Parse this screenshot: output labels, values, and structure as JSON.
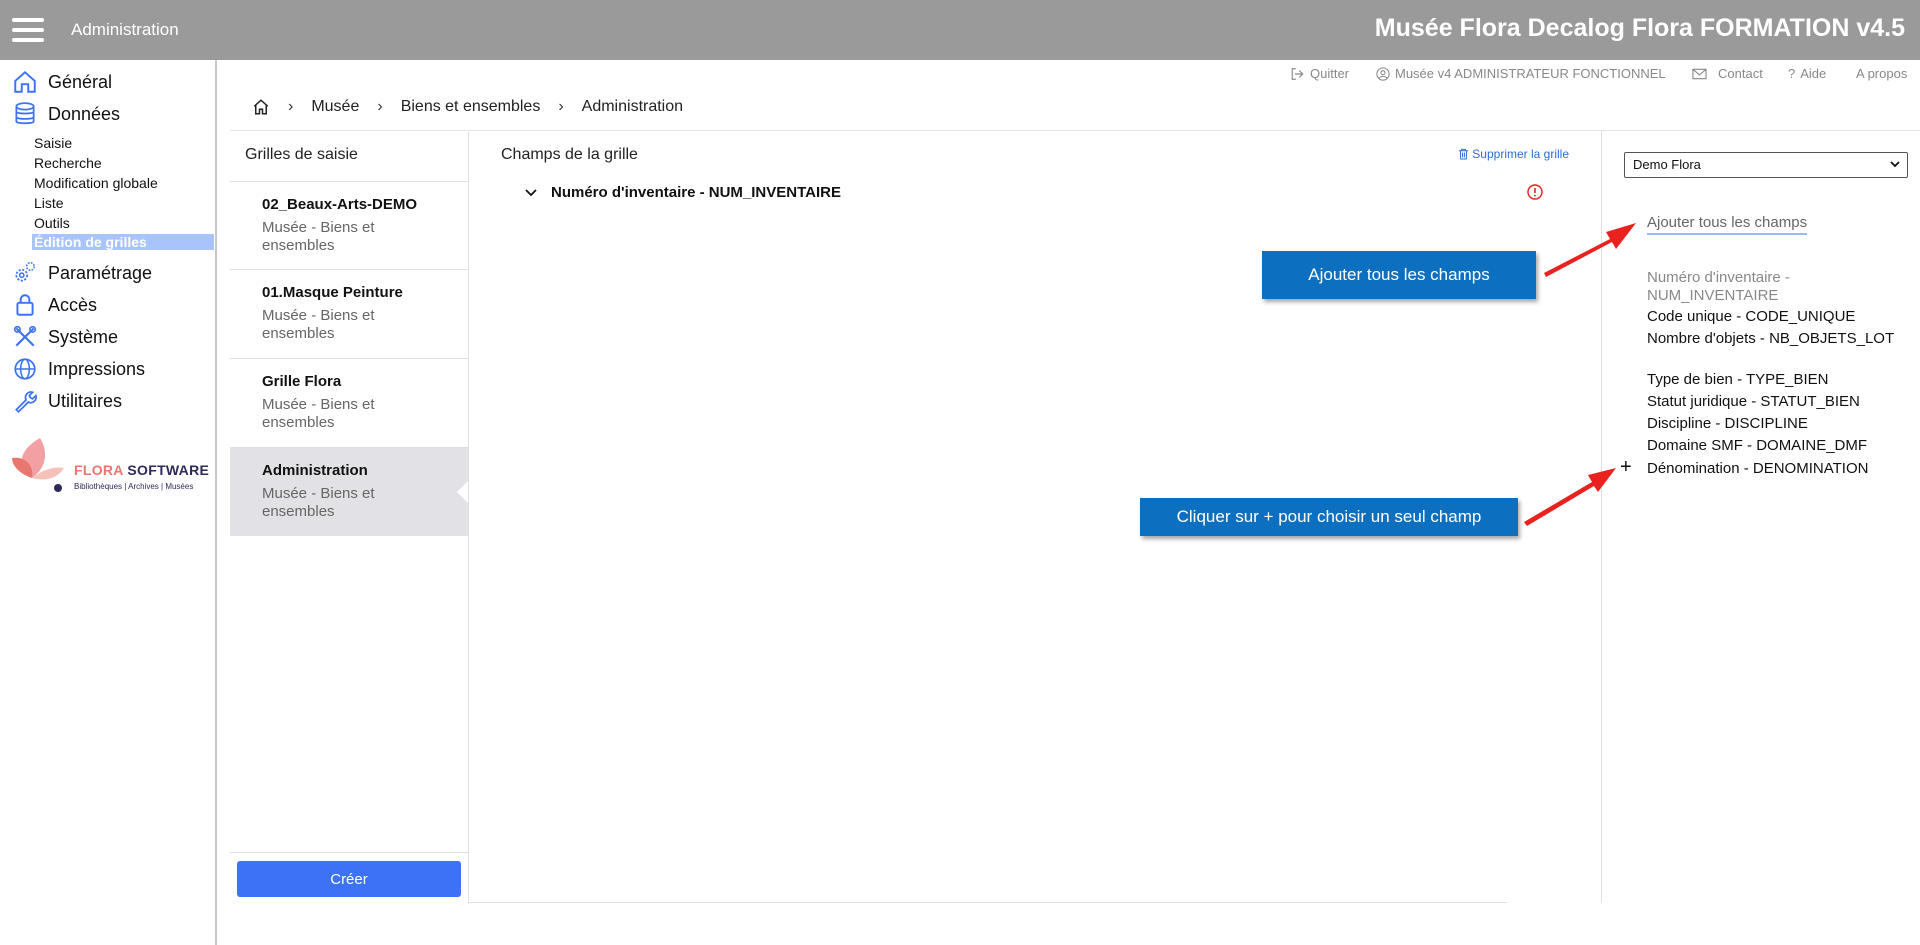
{
  "header": {
    "section": "Administration",
    "app_title": "Musée Flora Decalog Flora FORMATION v4.5"
  },
  "sidebar": {
    "main_items": [
      {
        "label": "Général",
        "icon": "home-icon"
      },
      {
        "label": "Données",
        "icon": "database-icon"
      },
      {
        "label": "Paramétrage",
        "icon": "gears-icon"
      },
      {
        "label": "Accès",
        "icon": "lock-icon"
      },
      {
        "label": "Système",
        "icon": "tools-icon"
      },
      {
        "label": "Impressions",
        "icon": "globe-icon"
      },
      {
        "label": "Utilitaires",
        "icon": "wrench-icon"
      }
    ],
    "sub_items": [
      "Saisie",
      "Recherche",
      "Modification globale",
      "Liste",
      "Outils",
      "Édition de grilles"
    ],
    "active_sub": "Édition de grilles"
  },
  "logo": {
    "brand_flora": "FLORA",
    "brand_software": " SOFTWARE",
    "tagline": "Bibliothèques | Archives | Musées"
  },
  "toplinks": {
    "quit": "Quitter",
    "user": "Musée v4 ADMINISTRATEUR FONCTIONNEL",
    "contact": "Contact",
    "help": "Aide",
    "about": "A propos"
  },
  "breadcrumb": [
    "Musée",
    "Biens et ensembles",
    "Administration"
  ],
  "grids_panel": {
    "title": "Grilles de saisie",
    "items": [
      {
        "name": "02_Beaux-Arts-DEMO",
        "sub": "Musée - Biens et ensembles"
      },
      {
        "name": "01.Masque Peinture",
        "sub": "Musée - Biens et ensembles"
      },
      {
        "name": "Grille Flora",
        "sub": "Musée - Biens et ensembles"
      },
      {
        "name": "Administration",
        "sub": "Musée - Biens et ensembles"
      }
    ],
    "selected": "Administration",
    "create_label": "Créer"
  },
  "fields_panel": {
    "title": "Champs de la grille",
    "delete_label": "Supprimer la grille",
    "fields": [
      {
        "label": "Numéro d'inventaire - NUM_INVENTAIRE",
        "status": "error"
      }
    ]
  },
  "available_panel": {
    "select_value": "Demo Flora",
    "add_all_label": "Ajouter tous les champs",
    "fields": [
      {
        "label": "Numéro d'inventaire - NUM_INVENTAIRE",
        "state": "added"
      },
      {
        "label": "Code unique - CODE_UNIQUE",
        "state": "available"
      },
      {
        "label": "Nombre d'objets - NB_OBJETS_LOT",
        "state": "available"
      },
      {
        "label": "Type de bien - TYPE_BIEN",
        "state": "available"
      },
      {
        "label": "Statut juridique - STATUT_BIEN",
        "state": "available"
      },
      {
        "label": "Discipline - DISCIPLINE",
        "state": "available"
      },
      {
        "label": "Domaine SMF - DOMAINE_DMF",
        "state": "available"
      },
      {
        "label": "Dénomination - DENOMINATION",
        "state": "available"
      }
    ],
    "plus_symbol": "+"
  },
  "callouts": {
    "add_all": "Ajouter tous les champs",
    "plus_hint": "Cliquer sur + pour choisir un seul champ"
  },
  "colors": {
    "topbar": "#9a9a9a",
    "accent": "#3d72f7",
    "callout": "#0d6fbf",
    "arrow": "#e8231f",
    "active_sub": "#a9c4fd",
    "error": "#e0241b"
  }
}
